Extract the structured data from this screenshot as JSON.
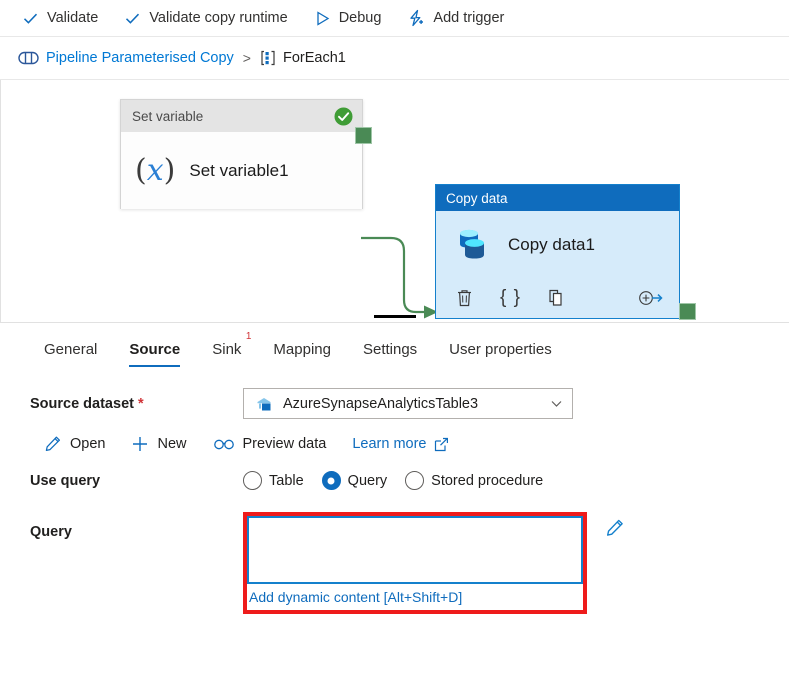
{
  "toolbar": {
    "items": [
      {
        "label": "Validate",
        "icon": "checkmark-icon"
      },
      {
        "label": "Validate copy runtime",
        "icon": "checkmark-icon"
      },
      {
        "label": "Debug",
        "icon": "play-triangle-icon"
      },
      {
        "label": "Add trigger",
        "icon": "lightning-plus-icon"
      }
    ]
  },
  "breadcrumb": {
    "root": "Pipeline Parameterised Copy",
    "separator": ">",
    "current": "ForEach1",
    "root_icon": "pipeline-icon",
    "current_icon": "foreach-icon"
  },
  "canvas": {
    "set_variable_node": {
      "header": "Set variable",
      "name": "Set variable1",
      "status_icon": "green-check-icon",
      "activity_icon": "fx-icon"
    },
    "copy_data_node": {
      "header": "Copy data",
      "name": "Copy data1",
      "activity_icon": "copy-data-database-icon",
      "actions": [
        {
          "name": "delete-activity-icon",
          "glyph": "trash"
        },
        {
          "name": "code-view-icon",
          "glyph": "braces"
        },
        {
          "name": "clone-activity-icon",
          "glyph": "copy"
        },
        {
          "name": "add-output-icon",
          "glyph": "plus-arrow"
        }
      ]
    },
    "colors": {
      "connector": "#4a8a55",
      "selected_header": "#0f6cbd",
      "selected_body": "#d6ebfa",
      "port": "#4a8a55"
    }
  },
  "tabs": [
    {
      "label": "General",
      "active": false,
      "badge": ""
    },
    {
      "label": "Source",
      "active": true,
      "badge": ""
    },
    {
      "label": "Sink",
      "active": false,
      "badge": "1"
    },
    {
      "label": "Mapping",
      "active": false,
      "badge": ""
    },
    {
      "label": "Settings",
      "active": false,
      "badge": ""
    },
    {
      "label": "User properties",
      "active": false,
      "badge": ""
    }
  ],
  "form": {
    "source_dataset": {
      "label": "Source dataset",
      "required_marker": "*",
      "value": "AzureSynapseAnalyticsTable3",
      "dataset_icon": "synapse-dataset-icon",
      "chevron_icon": "chevron-down-icon"
    },
    "links": [
      {
        "label": "Open",
        "icon": "pencil-icon",
        "style": "dark"
      },
      {
        "label": "New",
        "icon": "plus-icon",
        "style": "dark"
      },
      {
        "label": "Preview data",
        "icon": "glasses-icon",
        "style": "dark"
      },
      {
        "label": "Learn more",
        "icon": "external-link-icon",
        "style": "blue"
      }
    ],
    "use_query": {
      "label": "Use query",
      "options": [
        {
          "label": "Table",
          "selected": false
        },
        {
          "label": "Query",
          "selected": true
        },
        {
          "label": "Stored procedure",
          "selected": false
        }
      ]
    },
    "query": {
      "label": "Query",
      "value": "",
      "placeholder": "",
      "dynamic_content_link": "Add dynamic content [Alt+Shift+D]",
      "edit_icon": "pencil-icon",
      "highlight_color": "#ee1b1b",
      "focus_border_color": "#1480cc"
    }
  }
}
